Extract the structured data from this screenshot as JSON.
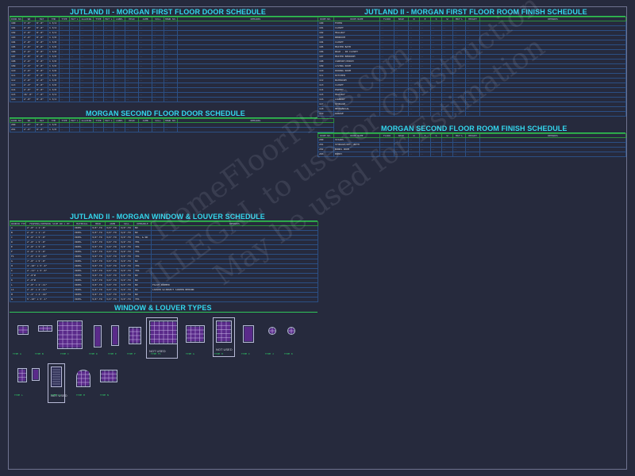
{
  "first_floor_door": {
    "title": "JUTLAND II - MORGAN FIRST FLOOR DOOR SCHEDULE",
    "headers": [
      "DOOR NO.",
      "WD",
      "HGT",
      "THK",
      "TYPE",
      "MAT'L",
      "GLAZING",
      "TYPE",
      "MAT'L",
      "LABEL",
      "HEAD",
      "JAMB",
      "SILL",
      "HDWR NO.",
      "REMARKS"
    ],
    "rows": [
      [
        "100",
        "3'-0\"",
        "8'-0\"",
        "1 3/4"
      ],
      [
        "101",
        "2'-8\"",
        "8'-0\"",
        "1 3/4"
      ],
      [
        "102",
        "2'-8\"",
        "8'-0\"",
        "1 3/4"
      ],
      [
        "103",
        "2'-6\"",
        "8'-0\"",
        "1 3/8"
      ],
      [
        "104",
        "2'-8\"",
        "8'-0\"",
        "1 3/8"
      ],
      [
        "105",
        "2'-6\"",
        "8'-0\"",
        "1 3/8"
      ],
      [
        "106",
        "2'-6\"",
        "8'-0\"",
        "1 3/8"
      ],
      [
        "107",
        "2'-8\"",
        "8'-0\"",
        "1 3/8"
      ],
      [
        "108",
        "2'-6\"",
        "8'-0\"",
        "1 3/8"
      ],
      [
        "109",
        "2'-4\"",
        "8'-0\"",
        "1 3/8"
      ],
      [
        "110",
        "2'-6\"",
        "8'-0\"",
        "1 3/8"
      ],
      [
        "111",
        "2'-6\"",
        "8'-0\"",
        "1 3/8"
      ],
      [
        "112",
        "2'-8\"",
        "8'-0\"",
        "1 3/8"
      ],
      [
        "113",
        "2'-4\"",
        "8'-0\"",
        "1 3/8"
      ],
      [
        "114",
        "2'-8\"",
        "8'-0\"",
        "1 3/8"
      ],
      [
        "115",
        "16'-0\"",
        "7'-0\"",
        "1 3/4"
      ],
      [
        "116",
        "2'-8\"",
        "8'-0\"",
        "1 3/4"
      ]
    ]
  },
  "second_floor_door": {
    "title": "MORGAN SECOND FLOOR DOOR SCHEDULE",
    "headers": [
      "DOOR NO.",
      "WD",
      "HGT",
      "THK",
      "TYPE",
      "MAT'L",
      "GLAZING",
      "TYPE",
      "MAT'L",
      "LABEL",
      "HEAD",
      "JAMB",
      "SILL",
      "HDWR NO.",
      "REMARKS"
    ],
    "rows": [
      [
        "200",
        "2'-6\"",
        "8'-0\"",
        "1 3/8"
      ],
      [
        "201",
        "2'-6\"",
        "8'-0\"",
        "1 3/8"
      ]
    ]
  },
  "first_floor_room": {
    "title": "JUTLAND II - MORGAN FIRST FLOOR ROOM FINISH SCHEDULE",
    "headers": [
      "ROOM NO.",
      "ROOM NAME",
      "FLOOR",
      "BASE",
      "N",
      "E",
      "S",
      "W",
      "MAT'L",
      "HEIGHT",
      "REMARKS"
    ],
    "rows": [
      [
        "100",
        "FOYER"
      ],
      [
        "101",
        "CLOSET"
      ],
      [
        "102",
        "HALLWAY"
      ],
      [
        "103",
        "BEDROOM"
      ],
      [
        "104",
        "CLOSET"
      ],
      [
        "105",
        "MASTER BATH"
      ],
      [
        "106",
        "WALK - IN CLOSET"
      ],
      [
        "107",
        "MASTER BEDROOM"
      ],
      [
        "108",
        "CARPORT/PORCH"
      ],
      [
        "109",
        "LIVING ROOM"
      ],
      [
        "110",
        "DINING ROOM"
      ],
      [
        "111",
        "KITCHEN"
      ],
      [
        "112",
        "BATHROOM"
      ],
      [
        "113",
        "CLOSET"
      ],
      [
        "114",
        "PANTRY"
      ],
      [
        "115",
        "HALLWAY"
      ],
      [
        "116",
        "LAUNDRY"
      ],
      [
        "117",
        "STORAGE"
      ],
      [
        "118",
        "MECHANICAL"
      ],
      [
        "119",
        "GARAGE"
      ]
    ]
  },
  "second_floor_room": {
    "title": "MORGAN SECOND FLOOR ROOM FINISH SCHEDULE",
    "headers": [
      "ROOM NO.",
      "ROOM NAME",
      "FLOOR",
      "BASE",
      "N",
      "E",
      "S",
      "W",
      "MAT'L",
      "HEIGHT",
      "REMARKS"
    ],
    "rows": [
      [
        "200",
        "STAIRS"
      ],
      [
        "201",
        "STORAGE/OPT. BATH"
      ],
      [
        "202",
        "BONUS ROOM"
      ],
      [
        "203",
        "ENTRY"
      ]
    ]
  },
  "window_louver": {
    "title": "JUTLAND II - MORGAN WINDOW & LOUVER SCHEDULE",
    "headers": [
      "WINDOW TYPE",
      "FRAMING/OPENING SIZE WD x HT",
      "MATERIAL",
      "HEAD",
      "JAMB",
      "SILL",
      "OPERABLE",
      "REMARKS"
    ],
    "rows": [
      [
        "A",
        "2'-0\" x 1'-0\"",
        "VINYL",
        "3/4\"-TO",
        "3/4\"-TO",
        "3/4\"-TO",
        "NO",
        ""
      ],
      [
        "B",
        "2'-0\" x 1'-4\"",
        "VINYL",
        "3/4\"-TO",
        "3/4\"-TO",
        "3/4\"-TO",
        "NO",
        ""
      ],
      [
        "C",
        "8'-0\" x 5'-0\"",
        "VINYL",
        "3/4\"-TO",
        "3/4\"-TO",
        "3/4\"-TO",
        "YES, & NO",
        ""
      ],
      [
        "D",
        "2'-0\" x 5'-0\"",
        "VINYL",
        "3/4\"-TO",
        "3/4\"-TO",
        "3/4\"-TO",
        "YES",
        ""
      ],
      [
        "E",
        "2'-0\" x 5'-0\"",
        "VINYL",
        "3/4\"-TO",
        "3/4\"-TO",
        "3/4\"-TO",
        "YES",
        ""
      ],
      [
        "F",
        "4'-0\" x 5'-0\"",
        "VINYL",
        "3/4\"-TO",
        "3/4\"-TO",
        "3/4\"-TO",
        "YES",
        ""
      ],
      [
        "F1",
        "7'-0\" x 6'-10\"",
        "VINYL",
        "3/4\"-TO",
        "3/4\"-TO",
        "3/4\"-TO",
        "YES",
        ""
      ],
      [
        "G",
        "7'-0\" x 5'-0\"",
        "VINYL",
        "3/4\"-TO",
        "3/4\"-TO",
        "3/4\"-TO",
        "NO",
        ""
      ],
      [
        "H",
        "4'-10\" x 5'-0\"",
        "VINYL",
        "3/4\"-TO",
        "3/4\"-TO",
        "3/4\"-TO",
        "YES",
        ""
      ],
      [
        "I",
        "2'-11\" x 5'-0\"",
        "VINYL",
        "3/4\"-TO",
        "3/4\"-TO",
        "3/4\"-TO",
        "YES",
        ""
      ],
      [
        "J",
        "2'-0\"Ø",
        "VINYL",
        "3/4\"-TO",
        "3/4\"-TO",
        "3/4\"-TO",
        "NO",
        ""
      ],
      [
        "K",
        "2'-0\"Ø",
        "VINYL",
        "3/4\"-TO",
        "3/4\"-TO",
        "3/4\"-TO",
        "NO",
        ""
      ],
      [
        "L",
        "2'-0\" x 2'-11\"",
        "VINYL",
        "3/4\"-TO",
        "3/4\"-TO",
        "3/4\"-TO",
        "NO",
        "FALSE DORMER"
      ],
      [
        "L1",
        "2'-0\" x 2'-11\"",
        "VINYL",
        "3/4\"-TO",
        "3/4\"-TO",
        "3/4\"-TO",
        "NO",
        "LOUVER W/INSECT SCREEN BEHIND"
      ],
      [
        "M",
        "5'-4\" x 4'-10\"",
        "VINYL",
        "3/4\"-TO",
        "3/4\"-TO",
        "3/4\"-TO",
        "NO",
        ""
      ],
      [
        "N",
        "5'-10\" x 5'-1\"",
        "VINYL",
        "3/4\"-TO",
        "3/4\"-TO",
        "3/4\"-TO",
        "YES",
        ""
      ]
    ]
  },
  "types": {
    "title": "WINDOW & LOUVER TYPES",
    "not_used": "NOT USED",
    "labels": [
      "TYPE A",
      "TYPE B",
      "TYPE C",
      "TYPE D",
      "TYPE E",
      "TYPE F",
      "TYPE F1",
      "TYPE G",
      "TYPE H",
      "TYPE I",
      "TYPE J",
      "TYPE K",
      "TYPE L",
      "TYPE L1",
      "TYPE M",
      "TYPE N"
    ]
  },
  "watermark": [
    "ILLEGAL to use for Construction",
    "May be used for Estimation",
    "HomeFloorPlans.com"
  ]
}
